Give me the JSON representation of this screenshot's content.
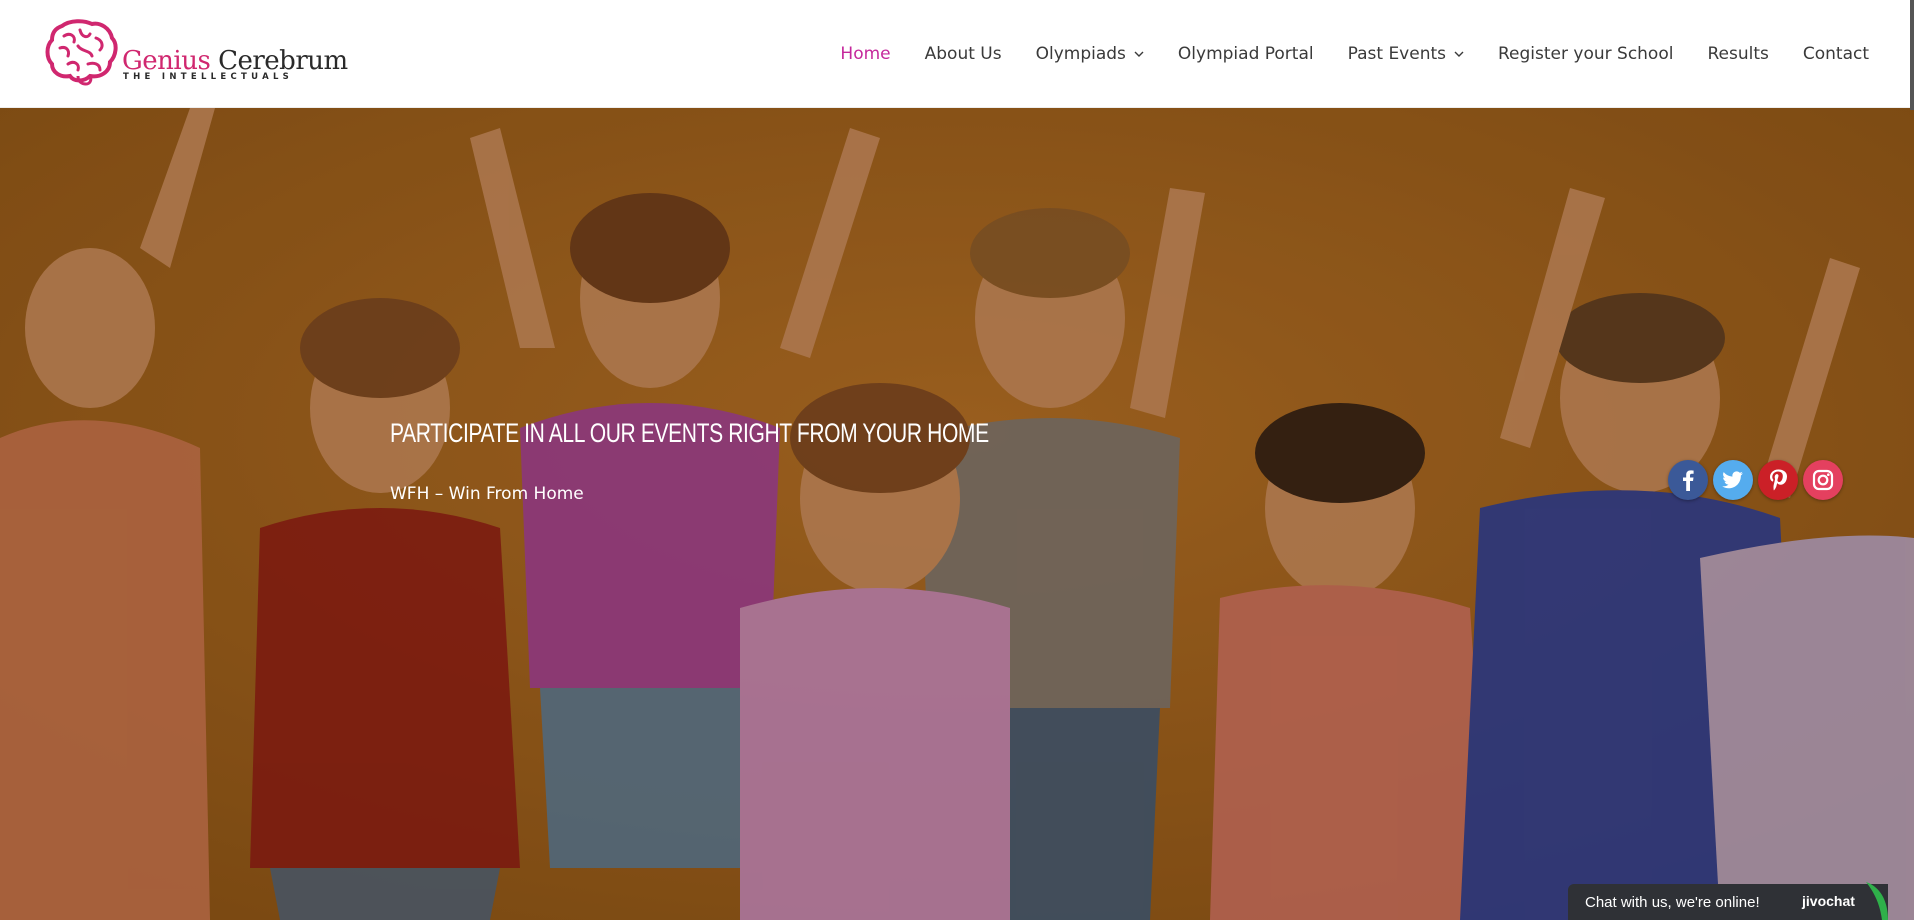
{
  "header": {
    "logo": {
      "word_primary": "Genius",
      "word_secondary": "Cerebrum",
      "tagline": "THE INTELLECTUALS",
      "brand_color": "#d0276f"
    },
    "nav": [
      {
        "label": "Home",
        "active": true
      },
      {
        "label": "About Us"
      },
      {
        "label": "Olympiads",
        "has_dropdown": true
      },
      {
        "label": "Olympiad Portal"
      },
      {
        "label": "Past Events",
        "has_dropdown": true
      },
      {
        "label": "Register your School"
      },
      {
        "label": "Results"
      },
      {
        "label": "Contact"
      }
    ],
    "active_color": "#c5289c"
  },
  "hero": {
    "title": "PARTICIPATE IN ALL OUR EVENTS RIGHT FROM YOUR HOME",
    "subtitle": "WFH – Win From Home",
    "background_color": "#a4621e",
    "image": "group of excited children raising arms"
  },
  "social": [
    {
      "name": "facebook",
      "icon": "facebook-icon",
      "color": "#3b5998"
    },
    {
      "name": "twitter",
      "icon": "twitter-icon",
      "color": "#55acee"
    },
    {
      "name": "pinterest",
      "icon": "pinterest-icon",
      "color": "#cb2027"
    },
    {
      "name": "instagram",
      "icon": "instagram-icon",
      "color": "#e4405f"
    }
  ],
  "chat": {
    "text": "Chat with us, we're online!",
    "brand": "jivochat",
    "accent": "#2fb04a"
  }
}
